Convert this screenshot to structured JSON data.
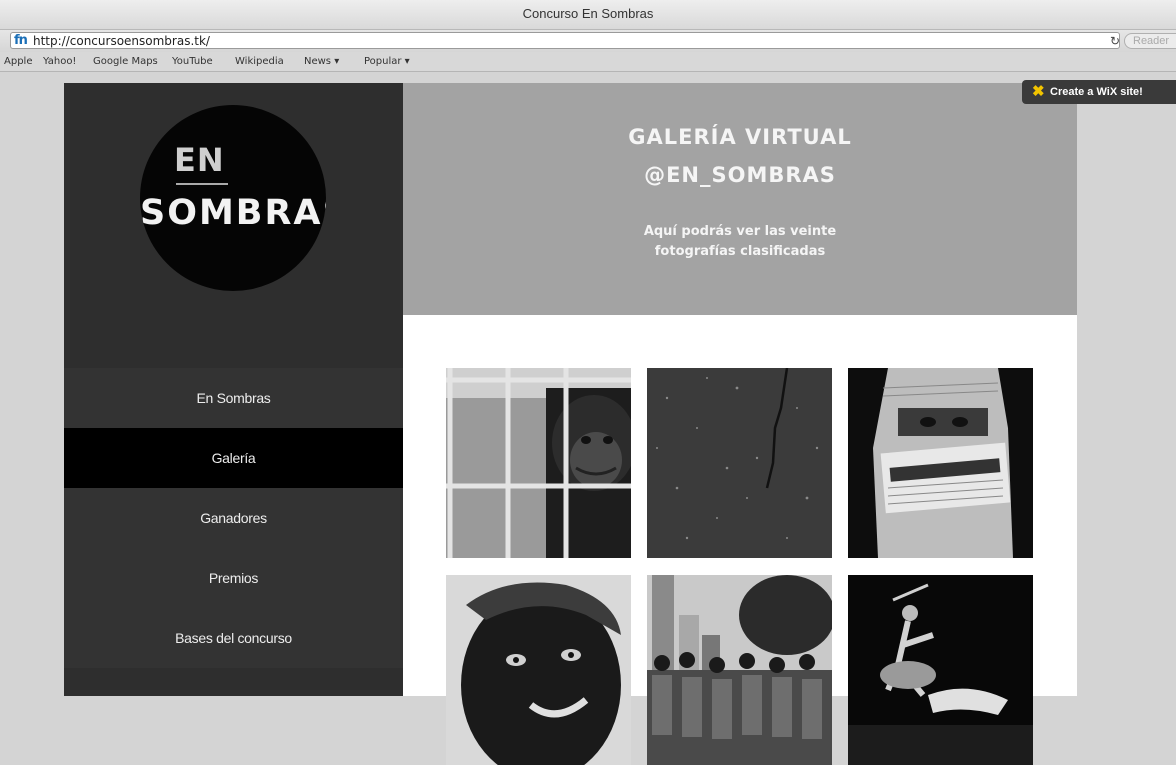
{
  "browser": {
    "window_title": "Concurso En Sombras",
    "url": "http://concursoensombras.tk/",
    "favicon_text": "fn",
    "reader_label": "Reader",
    "bookmarks": [
      "Apple",
      "Yahoo!",
      "Google Maps",
      "YouTube",
      "Wikipedia",
      "News ▾",
      "Popular ▾"
    ]
  },
  "logo": {
    "top_text": "EN",
    "bottom_text": "SOMBRAS"
  },
  "nav": {
    "items": [
      {
        "label": "En Sombras"
      },
      {
        "label": "Galería"
      },
      {
        "label": "Ganadores"
      },
      {
        "label": "Premios"
      },
      {
        "label": "Bases del concurso"
      }
    ],
    "active_index": 1
  },
  "header": {
    "title_line1": "GALERÍA VIRTUAL",
    "title_line2": "@EN_SOMBRAS",
    "subtitle_line1": "Aquí podrás ver las veinte",
    "subtitle_line2": "fotografías clasificadas"
  },
  "gallery": {
    "photos": [
      {
        "subject": "chimpanzee behind bars"
      },
      {
        "subject": "asphalt with crack"
      },
      {
        "subject": "person wrapped in newspaper"
      },
      {
        "subject": "face with painted skin"
      },
      {
        "subject": "street crowd with buildings"
      },
      {
        "subject": "dancer on dark stage"
      }
    ]
  },
  "wix_badge": {
    "label": "Create a WiX site!"
  },
  "colors": {
    "sidebar_bg": "#2e2e2e",
    "nav_active_bg": "#000000",
    "header_bg": "#a3a3a3",
    "page_bg": "#d4d4d4"
  }
}
